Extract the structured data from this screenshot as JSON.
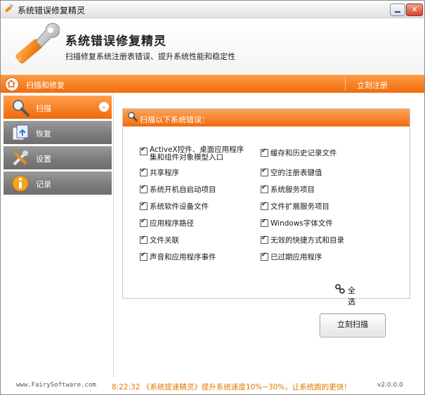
{
  "window": {
    "title": "系统错误修复精灵"
  },
  "header": {
    "app_name": "系统错误修复精灵",
    "slogan": "扫描修复系统注册表错误、提升系统性能和稳定性"
  },
  "navbar": {
    "section_label": "扫描和修复",
    "register_label": "立刻注册"
  },
  "sidebar": {
    "items": [
      {
        "label": "扫描",
        "icon": "magnifier-icon",
        "active": true
      },
      {
        "label": "恢复",
        "icon": "restore-icon",
        "active": false
      },
      {
        "label": "设置",
        "icon": "tools-icon",
        "active": false
      },
      {
        "label": "记录",
        "icon": "info-icon",
        "active": false
      }
    ]
  },
  "panel": {
    "title": "扫描以下系统错误：",
    "options_left": [
      "ActiveX控件、桌面应用程序集和组件对象模型入口",
      "共享程序",
      "系统开机自启动项目",
      "系统软件设备文件",
      "应用程序路径",
      "文件关联",
      "声音和应用程序事件"
    ],
    "options_right": [
      "缓存和历史记录文件",
      "空的注册表键值",
      "系统服务项目",
      "文件扩展服务项目",
      "Windows字体文件",
      "无效的快捷方式和目录",
      "已过期应用程序"
    ],
    "select_all_label": "全选"
  },
  "scan_button": {
    "label": "立刻扫描"
  },
  "footer": {
    "website": "www.FairySoftware.com",
    "promo": "8:22:32 《系统提速精灵》提升系统速度10%~30%，让系统跑的更快！",
    "version": "v2.0.0.0"
  },
  "colors": {
    "accent": "#ef6d0c",
    "sidebar_inactive": "#7d7d7d",
    "promo_text": "#e07a00"
  }
}
